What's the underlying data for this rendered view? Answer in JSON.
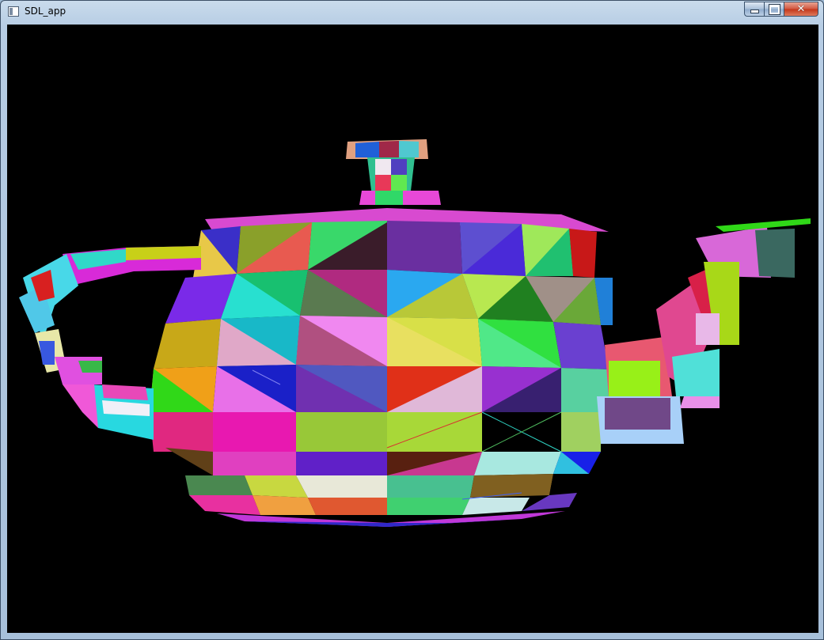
{
  "window": {
    "title": "SDL_app",
    "icon": "app-window-icon",
    "buttons": {
      "minimize": "minimize-icon",
      "maximize": "maximize-icon",
      "close": "close-icon"
    },
    "close_glyph": "✕"
  },
  "scene": {
    "description_kind": "rendered-3d-model",
    "background": "#000000"
  }
}
